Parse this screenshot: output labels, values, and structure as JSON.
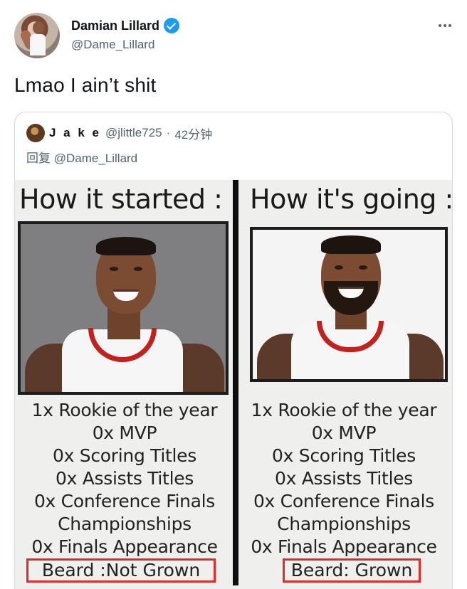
{
  "tweet": {
    "author_name": "Damian Lillard",
    "author_handle": "@Dame_Lillard",
    "text": "Lmao I ain’t shit"
  },
  "quote": {
    "author_name": "J a k e",
    "author_handle": "@jlittle725",
    "separator": "·",
    "time": "42分钟",
    "reply_to": "回复 @Dame_Lillard"
  },
  "meme": {
    "left": {
      "title": "How it started :",
      "stats": [
        "1x Rookie of the year",
        "0x MVP",
        "0x Scoring Titles",
        "0x Assists Titles",
        "0x Conference Finals",
        "Championships",
        "0x Finals Appearance"
      ],
      "beard": "Beard :Not Grown"
    },
    "right": {
      "title": "How it's going :",
      "stats": [
        "1x Rookie of the year",
        "0x MVP",
        "0x Scoring Titles",
        "0x Assists Titles",
        "0x Conference Finals",
        "Championships",
        "0x Finals Appearance"
      ],
      "beard": "Beard: Grown"
    }
  },
  "icons": {
    "verified": "verified-badge-icon",
    "more": "more-options-icon"
  },
  "colors": {
    "accent": "#1d9bf0",
    "secondary_text": "#536471",
    "highlight_box": "#e12a2a"
  }
}
